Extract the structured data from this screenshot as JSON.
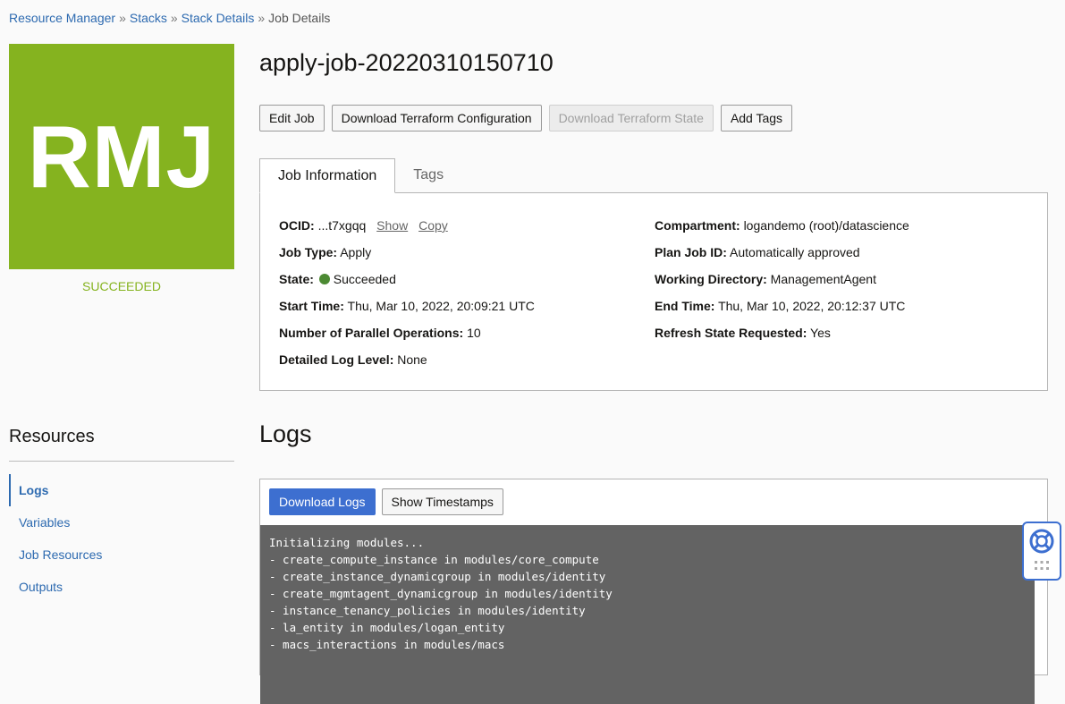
{
  "breadcrumb": {
    "items": [
      "Resource Manager",
      "Stacks",
      "Stack Details"
    ],
    "current": "Job Details",
    "separator": "»"
  },
  "badge": {
    "text": "RMJ",
    "status": "SUCCEEDED",
    "color": "#85b31f"
  },
  "job": {
    "title": "apply-job-20220310150710"
  },
  "actions": {
    "edit_job": "Edit Job",
    "download_tf_config": "Download Terraform Configuration",
    "download_tf_state": "Download Terraform State",
    "add_tags": "Add Tags"
  },
  "tabs": {
    "job_info": "Job Information",
    "tags": "Tags"
  },
  "info": {
    "ocid_label": "OCID:",
    "ocid_value": "...t7xgqq",
    "show": "Show",
    "copy": "Copy",
    "job_type_label": "Job Type:",
    "job_type_value": "Apply",
    "state_label": "State:",
    "state_value": "Succeeded",
    "start_label": "Start Time:",
    "start_value": "Thu, Mar 10, 2022, 20:09:21 UTC",
    "parallel_label": "Number of Parallel Operations:",
    "parallel_value": "10",
    "log_level_label": "Detailed Log Level:",
    "log_level_value": "None",
    "compartment_label": "Compartment:",
    "compartment_value": "logandemo (root)/datascience",
    "plan_label": "Plan Job ID:",
    "plan_value": "Automatically approved",
    "workdir_label": "Working Directory:",
    "workdir_value": "ManagementAgent",
    "end_label": "End Time:",
    "end_value": "Thu, Mar 10, 2022, 20:12:37 UTC",
    "refresh_label": "Refresh State Requested:",
    "refresh_value": "Yes"
  },
  "resources": {
    "title": "Resources",
    "items": [
      "Logs",
      "Variables",
      "Job Resources",
      "Outputs"
    ]
  },
  "logs": {
    "title": "Logs",
    "download": "Download Logs",
    "timestamps": "Show Timestamps",
    "lines": [
      "Initializing modules...",
      "- create_compute_instance in modules/core_compute",
      "- create_instance_dynamicgroup in modules/identity",
      "- create_mgmtagent_dynamicgroup in modules/identity",
      "- instance_tenancy_policies in modules/identity",
      "- la_entity in modules/logan_entity",
      "- macs_interactions in modules/macs"
    ]
  },
  "help_widget": {
    "icon": "lifebuoy-icon",
    "grid_icon": "grid-icon"
  },
  "colors": {
    "link": "#2d6ab0",
    "primary": "#3d6fd0",
    "console_bg": "#636363",
    "state_dot": "#4c8a33"
  }
}
